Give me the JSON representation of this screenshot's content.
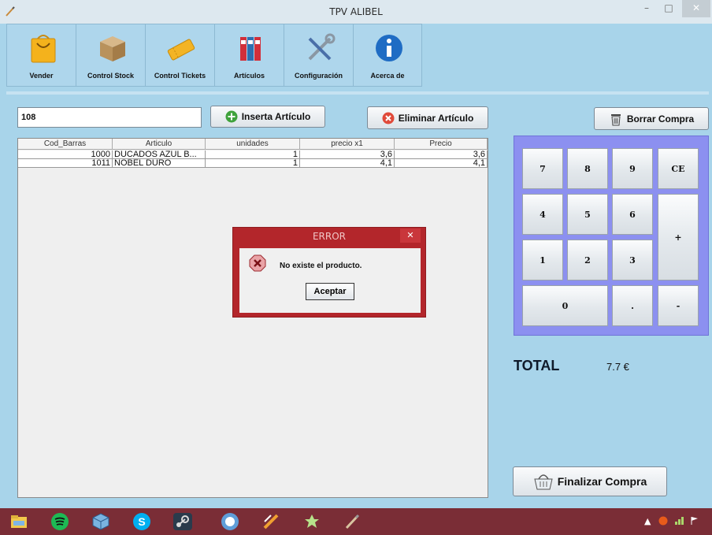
{
  "window": {
    "title": "TPV ALIBEL",
    "min_glyph": "–",
    "max_glyph": "□",
    "close_glyph": "✕"
  },
  "toolbar": {
    "items": [
      {
        "label": "Vender",
        "icon": "shopping-bag-icon"
      },
      {
        "label": "Control Stock",
        "icon": "box-icon"
      },
      {
        "label": "Control Tickets",
        "icon": "ticket-icon"
      },
      {
        "label": "Artículos",
        "icon": "binders-icon"
      },
      {
        "label": "Configuración",
        "icon": "tools-icon"
      },
      {
        "label": "Acerca de",
        "icon": "info-icon"
      }
    ]
  },
  "entry": {
    "code_value": "108"
  },
  "buttons": {
    "insert": "Inserta Artículo",
    "delete": "Eliminar Artículo",
    "clear": "Borrar Compra",
    "finish": "Finalizar Compra"
  },
  "table": {
    "headers": [
      "Cod_Barras",
      "Articulo",
      "unidades",
      "precio x1",
      "Precio"
    ],
    "rows": [
      [
        "1000",
        "DUCADOS AZUL B...",
        "1",
        "3,6",
        "3,6"
      ],
      [
        "1011",
        "NOBEL DURO",
        "1",
        "4,1",
        "4,1"
      ]
    ]
  },
  "keypad": {
    "keys": {
      "k7": "7",
      "k8": "8",
      "k9": "9",
      "ce": "CE",
      "k4": "4",
      "k5": "5",
      "k6": "6",
      "plus": "+",
      "k1": "1",
      "k2": "2",
      "k3": "3",
      "k0": "0",
      "dot": ".",
      "minus": "-"
    }
  },
  "total": {
    "label": "TOTAL",
    "value": "7.7 €"
  },
  "dialog": {
    "title": "ERROR",
    "close_glyph": "✕",
    "message": "No existe el producto.",
    "ok_label": "Aceptar"
  },
  "colors": {
    "background": "#a8d4ea",
    "keypad": "#8c90f0",
    "dialog_frame": "#b3262b",
    "taskbar": "#7a2d36"
  },
  "taskbar": {
    "apps": [
      "file-explorer-icon",
      "spotify-icon",
      "virtualbox-icon",
      "skype-icon",
      "steam-icon",
      "messenger-icon",
      "sublime-icon",
      "photo-icon",
      "pen-app-icon"
    ],
    "tray": [
      "tray-arrow-icon",
      "antivirus-icon",
      "network-icon",
      "flag-icon"
    ]
  }
}
